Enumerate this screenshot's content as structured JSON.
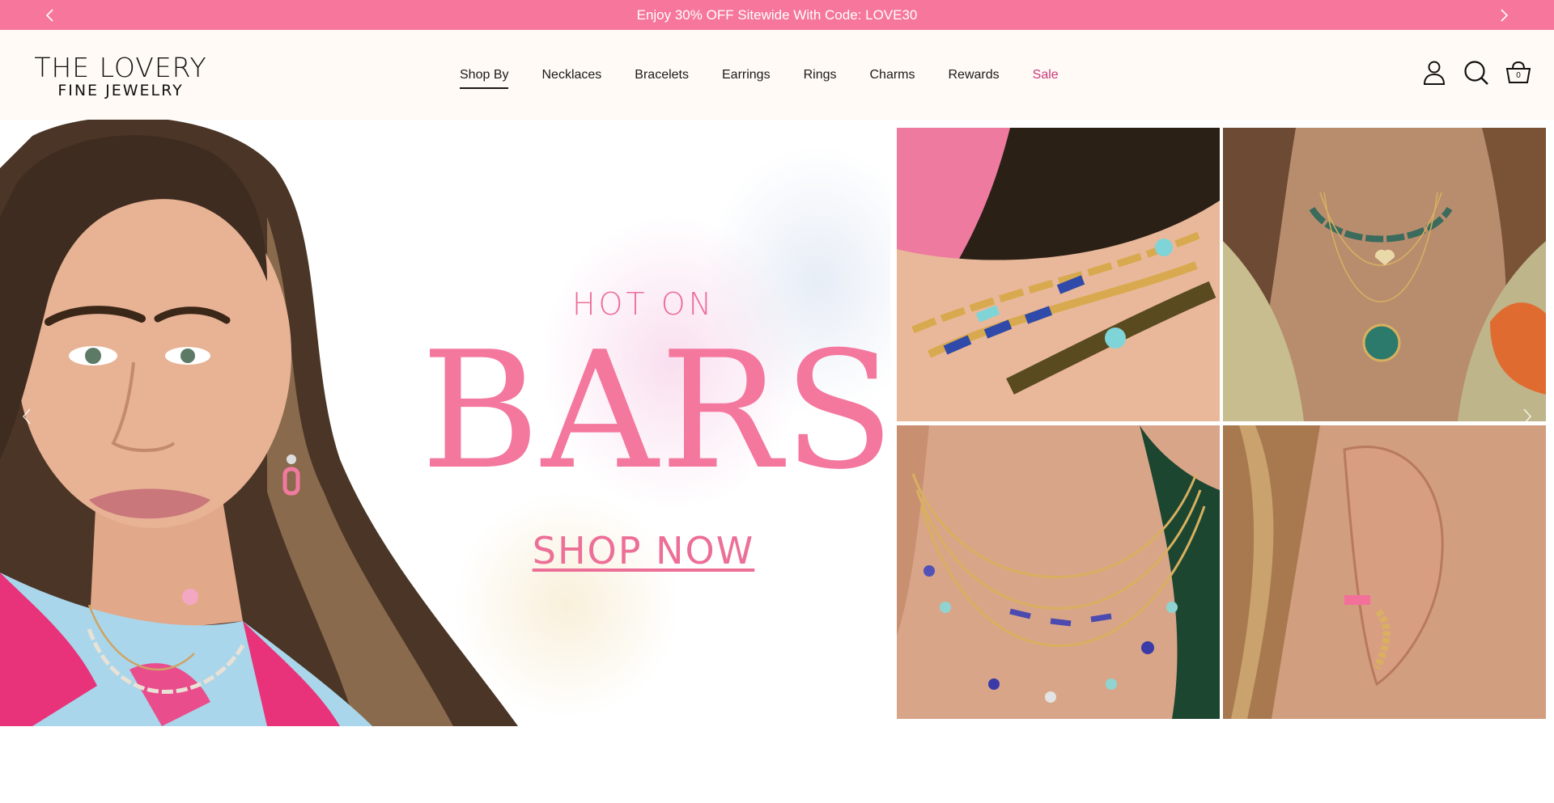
{
  "announcement": {
    "text": "Enjoy 30% OFF Sitewide With Code: LOVE30",
    "prev_icon": "chevron-left-icon",
    "next_icon": "chevron-right-icon",
    "background": "#f6779b"
  },
  "header": {
    "logo_line1": "THE LOVERY",
    "logo_line2": "FINE JEWELRY",
    "nav": [
      {
        "label": "Shop By",
        "active": true
      },
      {
        "label": "Necklaces"
      },
      {
        "label": "Bracelets"
      },
      {
        "label": "Earrings"
      },
      {
        "label": "Rings"
      },
      {
        "label": "Charms"
      },
      {
        "label": "Rewards"
      },
      {
        "label": "Sale",
        "highlight": "#c8397a"
      }
    ],
    "icons": [
      "account-icon",
      "search-icon",
      "cart-icon"
    ],
    "cart_count": "0"
  },
  "hero": {
    "kicker": "HOT ON",
    "headline": "BARS",
    "cta": "SHOP NOW",
    "accent": "#f4779e",
    "tiles": [
      "bracelets-stack-photo",
      "layered-necklaces-photo",
      "bar-station-necklaces-photo",
      "bar-earrings-photo"
    ]
  }
}
